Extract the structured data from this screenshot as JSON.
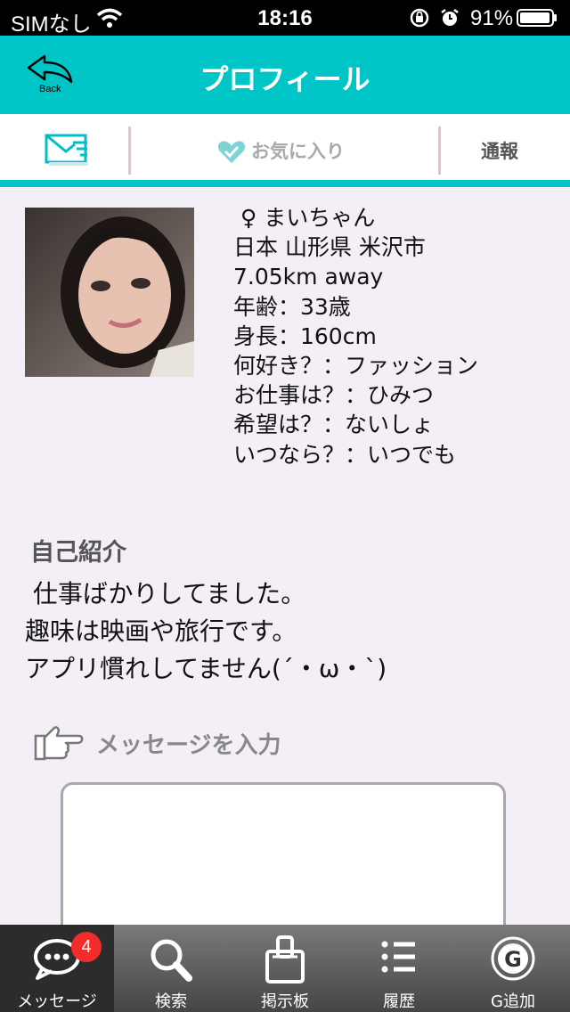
{
  "status_bar": {
    "carrier": "SIMなし",
    "time": "18:16",
    "battery": "91%"
  },
  "header": {
    "back_label": "Back",
    "title": "プロフィール",
    "accent_color": "#00c5c7"
  },
  "actions": {
    "mail_icon": "mail-icon",
    "favorite_label": "お気に入り",
    "report_label": "通報"
  },
  "profile": {
    "gender_symbol": "♀",
    "name": "まいちゃん",
    "location": "日本 山形県 米沢市",
    "distance": "7.05km away",
    "age": "年齢：33歳",
    "height": "身長：160cm",
    "likes": "何好き？：ファッション",
    "job": "お仕事は？：ひみつ",
    "wish": "希望は？：ないしょ",
    "when": "いつなら？：いつでも"
  },
  "intro": {
    "heading": "自己紹介",
    "body": " 仕事ばかりしてました。\n趣味は映画や旅行です。\nアプリ慣れしてません(´・ω・`)"
  },
  "message": {
    "prompt": "メッセージを入力",
    "value": ""
  },
  "tabs": [
    {
      "label": "メッセージ",
      "icon": "chat-bubble-icon",
      "badge": "4",
      "active": true
    },
    {
      "label": "検索",
      "icon": "search-icon"
    },
    {
      "label": "掲示板",
      "icon": "clipboard-icon"
    },
    {
      "label": "履歴",
      "icon": "list-icon"
    },
    {
      "label": "G追加",
      "icon": "g-add-icon"
    }
  ]
}
